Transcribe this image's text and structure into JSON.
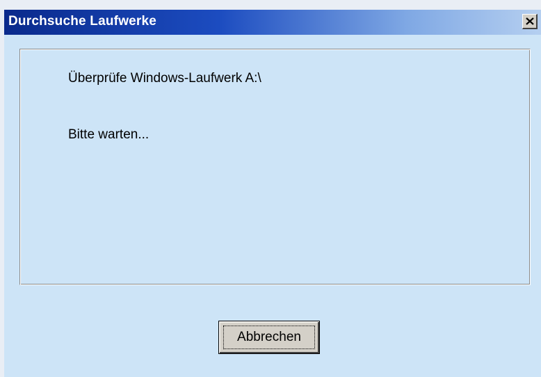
{
  "window": {
    "title": "Durchsuche Laufwerke",
    "close_icon": "close-icon"
  },
  "message": {
    "line1": "Überprüfe Windows-Laufwerk A:\\",
    "line2": "Bitte warten..."
  },
  "buttons": {
    "cancel_label": "Abbrechen"
  },
  "colors": {
    "title_bar_start": "#0a2a8c",
    "title_bar_end": "#b5cff0",
    "dialog_background": "#cde4f7",
    "button_face": "#d4d0c8"
  }
}
